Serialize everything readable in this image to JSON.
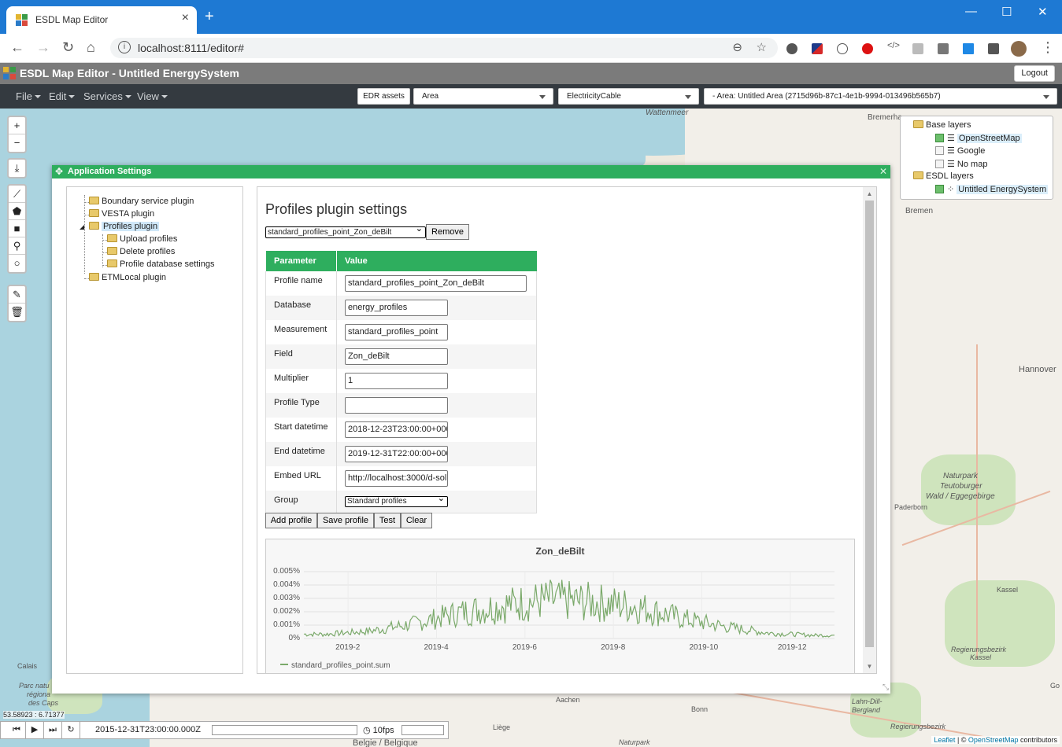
{
  "browser": {
    "tab_title": "ESDL Map Editor",
    "url": "localhost:8111/editor#"
  },
  "app": {
    "title": "ESDL Map Editor - Untitled EnergySystem",
    "logout": "Logout",
    "menus": [
      "File",
      "Edit",
      "Services",
      "View"
    ],
    "edr_button": "EDR assets",
    "area_select": "Area",
    "asset_select": "ElectricityCable",
    "area_path": "- Area: Untitled Area (2715d96b-87c1-4e1b-9994-013496b565b7)"
  },
  "layers": {
    "base_header": "Base layers",
    "base": [
      {
        "label": "OpenStreetMap",
        "checked": true
      },
      {
        "label": "Google",
        "checked": false
      },
      {
        "label": "No map",
        "checked": false
      }
    ],
    "esdl_header": "ESDL layers",
    "esdl": [
      {
        "label": "Untitled EnergySystem",
        "checked": true
      }
    ]
  },
  "map_labels": {
    "wattenmeer": "Wattenmeer",
    "bremerhaven": "Bremerha",
    "bremen": "Bremen",
    "hannover": "Hannover",
    "naturpark": "Naturpark",
    "teutoburger": "Teutoburger",
    "wald": "Wald / Eggegebirge",
    "paderborn": "Paderborn",
    "kassel": "Kassel",
    "regbez": "Regierungsbezirk",
    "regbez_kassel": "Kassel",
    "lahn": "Lahn-Dill-",
    "bergland": "Bergland",
    "regbez2": "Regierungsbezirk",
    "aachen": "Aachen",
    "bonn": "Bonn",
    "liege": "Liège",
    "belgique": "Belgie / Belgique",
    "naturpark2": "Naturpark",
    "calais": "Calais",
    "parc": "Parc natu",
    "region": "régiona",
    "caps": "des Caps",
    "go": "Go"
  },
  "coords": "53.58923 : 6.71377",
  "timebar": {
    "timestamp": "2015-12-31T23:00:00.000Z",
    "fps": "10fps"
  },
  "attribution": {
    "leaflet": "Leaflet",
    "sep": " | © ",
    "osm": "OpenStreetMap",
    "rest": " contributors"
  },
  "dialog": {
    "title": "Application Settings",
    "tree": [
      {
        "label": "Boundary service plugin",
        "level": 0
      },
      {
        "label": "VESTA plugin",
        "level": 0
      },
      {
        "label": "Profiles plugin",
        "level": 0,
        "selected": true
      },
      {
        "label": "Upload profiles",
        "level": 1
      },
      {
        "label": "Delete profiles",
        "level": 1
      },
      {
        "label": "Profile database settings",
        "level": 1
      },
      {
        "label": "ETMLocal plugin",
        "level": 0
      }
    ],
    "heading": "Profiles plugin settings",
    "profile_select": "standard_profiles_point_Zon_deBilt",
    "remove": "Remove",
    "table": {
      "col_param": "Parameter",
      "col_value": "Value",
      "rows": [
        {
          "label": "Profile name",
          "value": "standard_profiles_point_Zon_deBilt"
        },
        {
          "label": "Database",
          "value": "energy_profiles"
        },
        {
          "label": "Measurement",
          "value": "standard_profiles_point"
        },
        {
          "label": "Field",
          "value": "Zon_deBilt"
        },
        {
          "label": "Multiplier",
          "value": "1"
        },
        {
          "label": "Profile Type",
          "value": ""
        },
        {
          "label": "Start datetime",
          "value": "2018-12-23T23:00:00+000"
        },
        {
          "label": "End datetime",
          "value": "2019-12-31T22:00:00+000"
        },
        {
          "label": "Embed URL",
          "value": "http://localhost:3000/d-sol"
        },
        {
          "label": "Group",
          "value": "Standard profiles"
        }
      ]
    },
    "buttons": {
      "add": "Add profile",
      "save": "Save profile",
      "test": "Test",
      "clear": "Clear"
    }
  },
  "chart_data": {
    "type": "line",
    "title": "Zon_deBilt",
    "ylim": [
      0,
      0.005
    ],
    "y_ticks": [
      "0%",
      "0.001%",
      "0.002%",
      "0.003%",
      "0.004%",
      "0.005%"
    ],
    "x_ticks": [
      "2019-2",
      "2019-4",
      "2019-6",
      "2019-8",
      "2019-10",
      "2019-12"
    ],
    "series": [
      {
        "name": "standard_profiles_point.sum",
        "color": "#7aa96a",
        "x": [
          "2019-01",
          "2019-02",
          "2019-03",
          "2019-04",
          "2019-05",
          "2019-06",
          "2019-07",
          "2019-08",
          "2019-09",
          "2019-10",
          "2019-11",
          "2019-12"
        ],
        "values": [
          0.0004,
          0.0007,
          0.0014,
          0.0024,
          0.0031,
          0.0036,
          0.0034,
          0.003,
          0.0019,
          0.0011,
          0.0005,
          0.0003
        ]
      }
    ],
    "grid": true,
    "legend": "bottom-left"
  }
}
